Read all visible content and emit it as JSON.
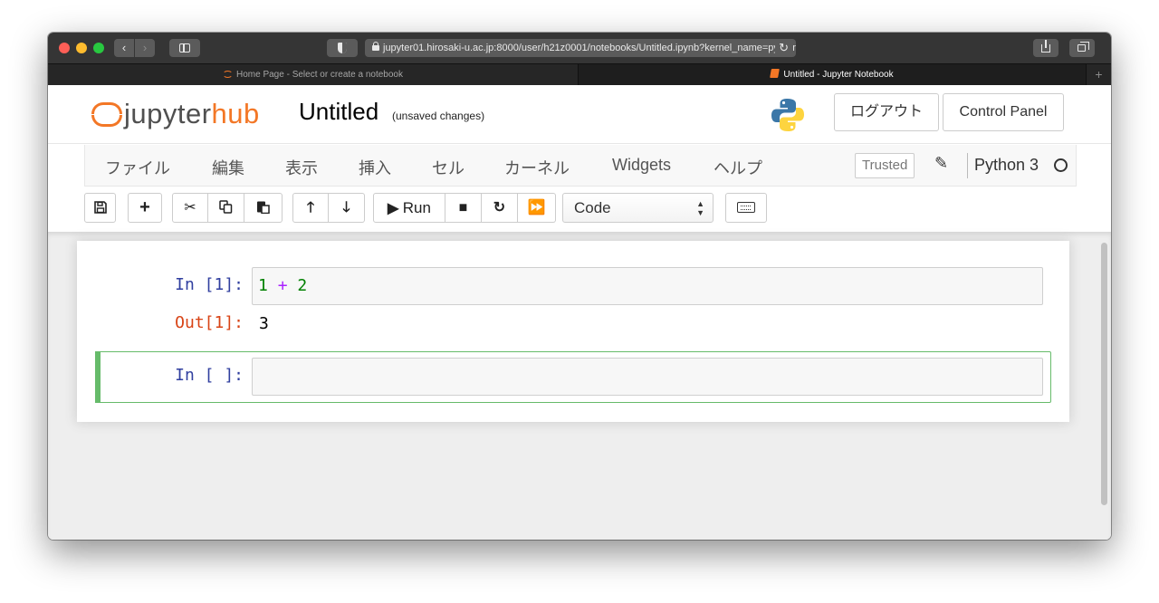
{
  "browser": {
    "url": "jupyter01.hirosaki-u.ac.jp:8000/user/h21z0001/notebooks/Untitled.ipynb?kernel_name=python3",
    "tabs": [
      {
        "label": "Home Page - Select or create a notebook",
        "active": false
      },
      {
        "label": "Untitled - Jupyter Notebook",
        "active": true
      }
    ],
    "new_tab": "+"
  },
  "header": {
    "logo_text_a": "jupyter",
    "logo_text_b": "hub",
    "notebook_title": "Untitled",
    "save_status": "(unsaved changes)",
    "logout_label": "ログアウト",
    "control_panel_label": "Control Panel"
  },
  "menu": {
    "items": [
      "ファイル",
      "編集",
      "表示",
      "挿入",
      "セル",
      "カーネル",
      "Widgets",
      "ヘルプ"
    ],
    "trusted_label": "Trusted",
    "kernel_name": "Python 3"
  },
  "toolbar": {
    "run_label": "Run",
    "cell_type": "Code",
    "icons": [
      "save-icon",
      "plus-icon",
      "cut-icon",
      "copy-icon",
      "paste-icon",
      "arrow-up-icon",
      "arrow-down-icon",
      "run-icon",
      "stop-icon",
      "restart-icon",
      "fast-forward-icon",
      "keyboard-icon"
    ]
  },
  "cells": [
    {
      "in_prompt": "In [1]:",
      "code": {
        "a": "1",
        "op": "+",
        "b": "2"
      },
      "out_prompt": "Out[1]:",
      "output": "3"
    },
    {
      "in_prompt": "In [ ]:",
      "code": ""
    }
  ],
  "colors": {
    "jupyter_orange": "#f37726",
    "in_prompt": "#303f9f",
    "out_prompt": "#d84315",
    "selected_cell": "#66bb6a"
  }
}
